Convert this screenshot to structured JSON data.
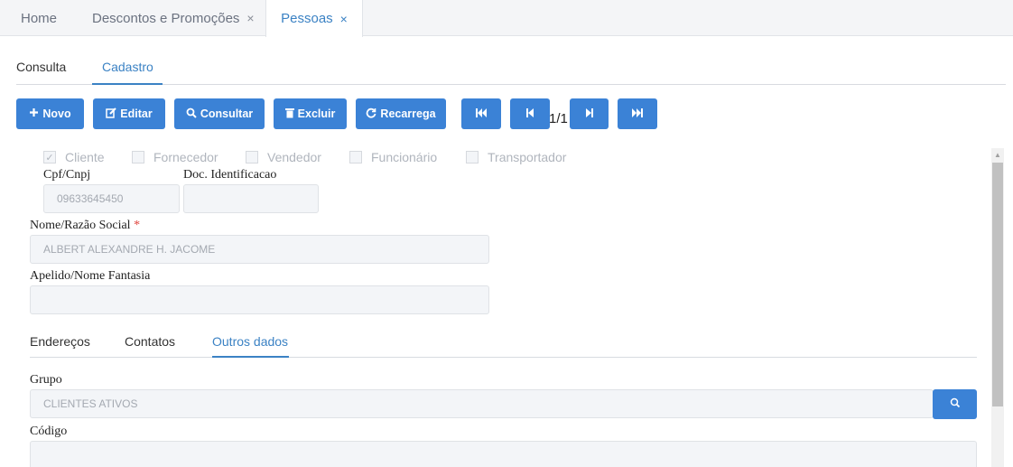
{
  "tabs": [
    {
      "label": "Home"
    },
    {
      "label": "Descontos e Promoções",
      "close": "×"
    },
    {
      "label": "Pessoas",
      "close": "×"
    }
  ],
  "subtabs": {
    "consulta": "Consulta",
    "cadastro": "Cadastro"
  },
  "toolbar": {
    "novo": "Novo",
    "editar": "Editar",
    "consultar": "Consultar",
    "excluir": "Excluir",
    "recarrega": "Recarrega",
    "pager": "1/1"
  },
  "checkboxes": {
    "cliente": {
      "label": "Cliente",
      "checked": true
    },
    "fornecedor": {
      "label": "Fornecedor",
      "checked": false
    },
    "vendedor": {
      "label": "Vendedor",
      "checked": false
    },
    "funcionario": {
      "label": "Funcionário",
      "checked": false
    },
    "transportador": {
      "label": "Transportador",
      "checked": false
    }
  },
  "form": {
    "cpf_label": "Cpf/Cnpj",
    "cpf_value": "09633645450",
    "doc_label": "Doc. Identificacao",
    "doc_value": "",
    "nome_label": "Nome/Razão Social",
    "nome_required": "*",
    "nome_value": "ALBERT ALEXANDRE H. JACOME",
    "apelido_label": "Apelido/Nome Fantasia",
    "apelido_value": ""
  },
  "inner_tabs": {
    "enderecos": "Endereços",
    "contatos": "Contatos",
    "outros": "Outros dados"
  },
  "outros": {
    "grupo_label": "Grupo",
    "grupo_value": "CLIENTES ATIVOS",
    "codigo_label": "Código",
    "codigo_value": ""
  },
  "colors": {
    "accent": "#3b82d6",
    "active_tab": "#3b82c4",
    "required": "#e0443d"
  }
}
